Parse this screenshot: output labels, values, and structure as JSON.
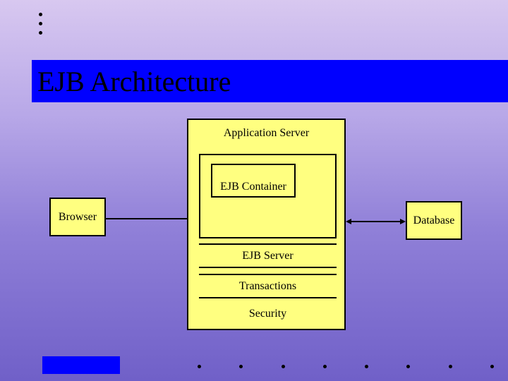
{
  "title": "EJB Architecture",
  "boxes": {
    "browser": "Browser",
    "database": "Database",
    "app_server": "Application Server",
    "ejb_container": "EJB Container",
    "ejb_server": "EJB Server",
    "transactions": "Transactions",
    "security": "Security"
  }
}
